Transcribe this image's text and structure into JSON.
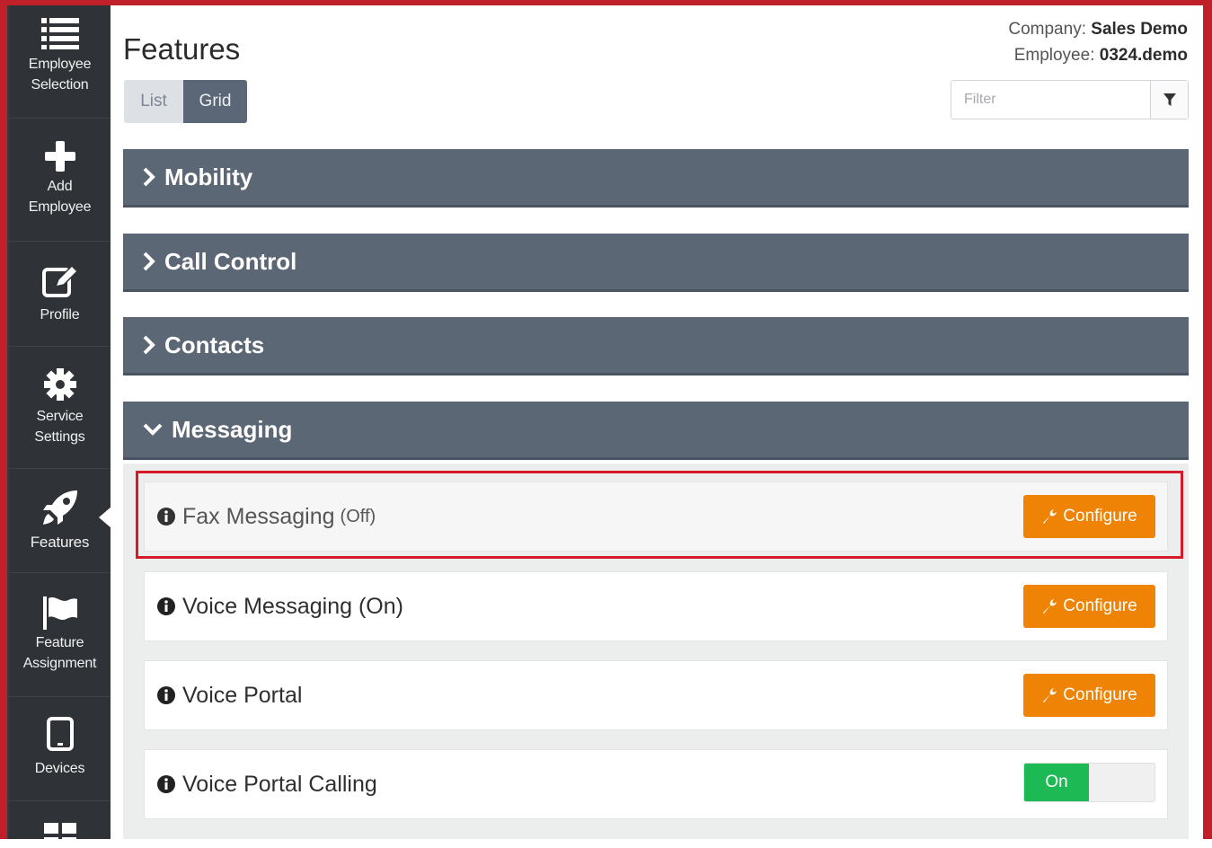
{
  "sidebar": {
    "items": [
      {
        "label_line1": "Employee",
        "label_line2": "Selection",
        "icon": "list-icon"
      },
      {
        "label_line1": "Add",
        "label_line2": "Employee",
        "icon": "plus-icon"
      },
      {
        "label_line1": "Profile",
        "label_line2": "",
        "icon": "edit-icon"
      },
      {
        "label_line1": "Service",
        "label_line2": "Settings",
        "icon": "gear-icon"
      },
      {
        "label_line1": "Features",
        "label_line2": "",
        "icon": "rocket-icon",
        "active": true
      },
      {
        "label_line1": "Feature",
        "label_line2": "Assignment",
        "icon": "flag-icon"
      },
      {
        "label_line1": "Devices",
        "label_line2": "",
        "icon": "tablet-icon"
      },
      {
        "label_line1": "",
        "label_line2": "",
        "icon": "grid-icon"
      }
    ]
  },
  "header": {
    "title": "Features",
    "view_toggle": {
      "list": "List",
      "grid": "Grid",
      "selected": "Grid"
    },
    "company_label": "Company:",
    "company_value": "Sales Demo",
    "employee_label": "Employee:",
    "employee_value": "0324.demo",
    "filter_placeholder": "Filter"
  },
  "panels": [
    {
      "label": "Mobility",
      "expanded": false
    },
    {
      "label": "Call Control",
      "expanded": false
    },
    {
      "label": "Contacts",
      "expanded": false
    },
    {
      "label": "Messaging",
      "expanded": true
    }
  ],
  "messaging_items": [
    {
      "name": "Fax Messaging",
      "status": "(Off)",
      "action": "Configure"
    },
    {
      "name": "Voice Messaging (On)",
      "status": "",
      "action": "Configure"
    },
    {
      "name": "Voice Portal",
      "status": "",
      "action": "Configure"
    },
    {
      "name": "Voice Portal Calling",
      "status": "",
      "toggle": "On"
    }
  ],
  "colors": {
    "sidebar_bg": "#2f3338",
    "panel_bg": "#5c6776",
    "configure_btn": "#ef8305",
    "toggle_on": "#1db954",
    "highlight": "#d6192b"
  }
}
